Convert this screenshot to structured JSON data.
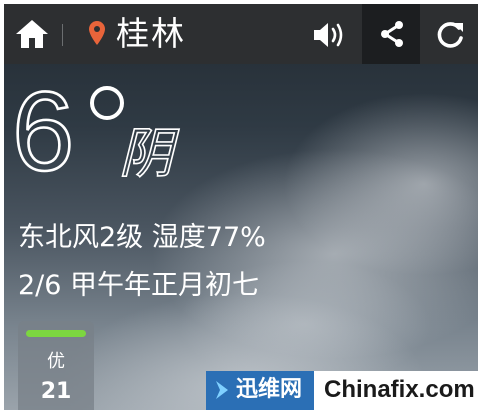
{
  "header": {
    "city": "桂林",
    "icons": {
      "home": "home-icon",
      "location": "location-pin-icon",
      "sound": "speaker-icon",
      "share": "share-icon",
      "refresh": "refresh-icon"
    },
    "pin_color": "#e8643a"
  },
  "weather": {
    "temperature": "6",
    "condition": "阴",
    "wind_humidity": "东北风2级 湿度77%",
    "date": "2/6 甲午年正月初七"
  },
  "air_quality": {
    "level": "优",
    "value": "21",
    "bar_color": "#7cd640"
  },
  "watermark": {
    "cn_text": "迅维网",
    "en_text": "Chinafix.com"
  }
}
